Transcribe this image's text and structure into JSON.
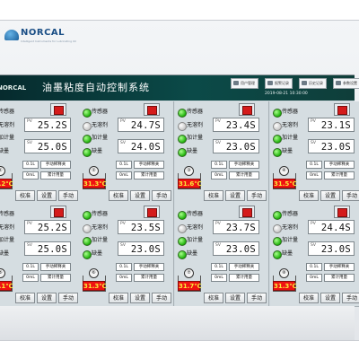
{
  "brand": {
    "name": "NORCAL",
    "tagline": "Intelligent Instruments for Lubricating Oil"
  },
  "titlebar": {
    "logo": "NORCAL",
    "title": "油墨粘度自动控制系统",
    "buttons": [
      "用户管理",
      "报警记录",
      "历史记录",
      "参数设置"
    ],
    "clock": "2019-08-21 10:30:00"
  },
  "status_labels": [
    "传感器",
    "无溶剂",
    "加计量",
    "缺墨"
  ],
  "labels": {
    "pv": "PV",
    "sv": "SV",
    "set_small": "0.1L",
    "manual_toggle": "手动稀释关",
    "amount": "0mL",
    "total": "累计用量",
    "calibrate": "校准",
    "settings": "设置",
    "manual": "手动"
  },
  "channels": [
    {
      "number": "①",
      "pv": "25.2S",
      "sv": "25.0S",
      "temp": "31.2℃",
      "leds": [
        "green",
        "gray",
        "green",
        "green"
      ]
    },
    {
      "number": "②",
      "pv": "24.7S",
      "sv": "24.0S",
      "temp": "31.3℃",
      "leds": [
        "green",
        "gray",
        "green",
        "green"
      ]
    },
    {
      "number": "③",
      "pv": "23.4S",
      "sv": "23.0S",
      "temp": "31.6℃",
      "leds": [
        "green",
        "gray",
        "green",
        "green"
      ]
    },
    {
      "number": "④",
      "pv": "23.1S",
      "sv": "23.0S",
      "temp": "31.5℃",
      "leds": [
        "green",
        "gray",
        "green",
        "green"
      ]
    },
    {
      "number": "⑤",
      "pv": "25.2S",
      "sv": "25.0S",
      "temp": "31.1℃",
      "leds": [
        "green",
        "gray",
        "green",
        "green"
      ]
    },
    {
      "number": "⑥",
      "pv": "23.5S",
      "sv": "23.0S",
      "temp": "31.3℃",
      "leds": [
        "green",
        "gray",
        "green",
        "green"
      ]
    },
    {
      "number": "⑦",
      "pv": "23.7S",
      "sv": "23.0S",
      "temp": "31.7℃",
      "leds": [
        "green",
        "gray",
        "green",
        "green"
      ]
    },
    {
      "number": "⑧",
      "pv": "24.4S",
      "sv": "23.0S",
      "temp": "31.3℃",
      "leds": [
        "green",
        "gray",
        "green",
        "green"
      ]
    }
  ]
}
